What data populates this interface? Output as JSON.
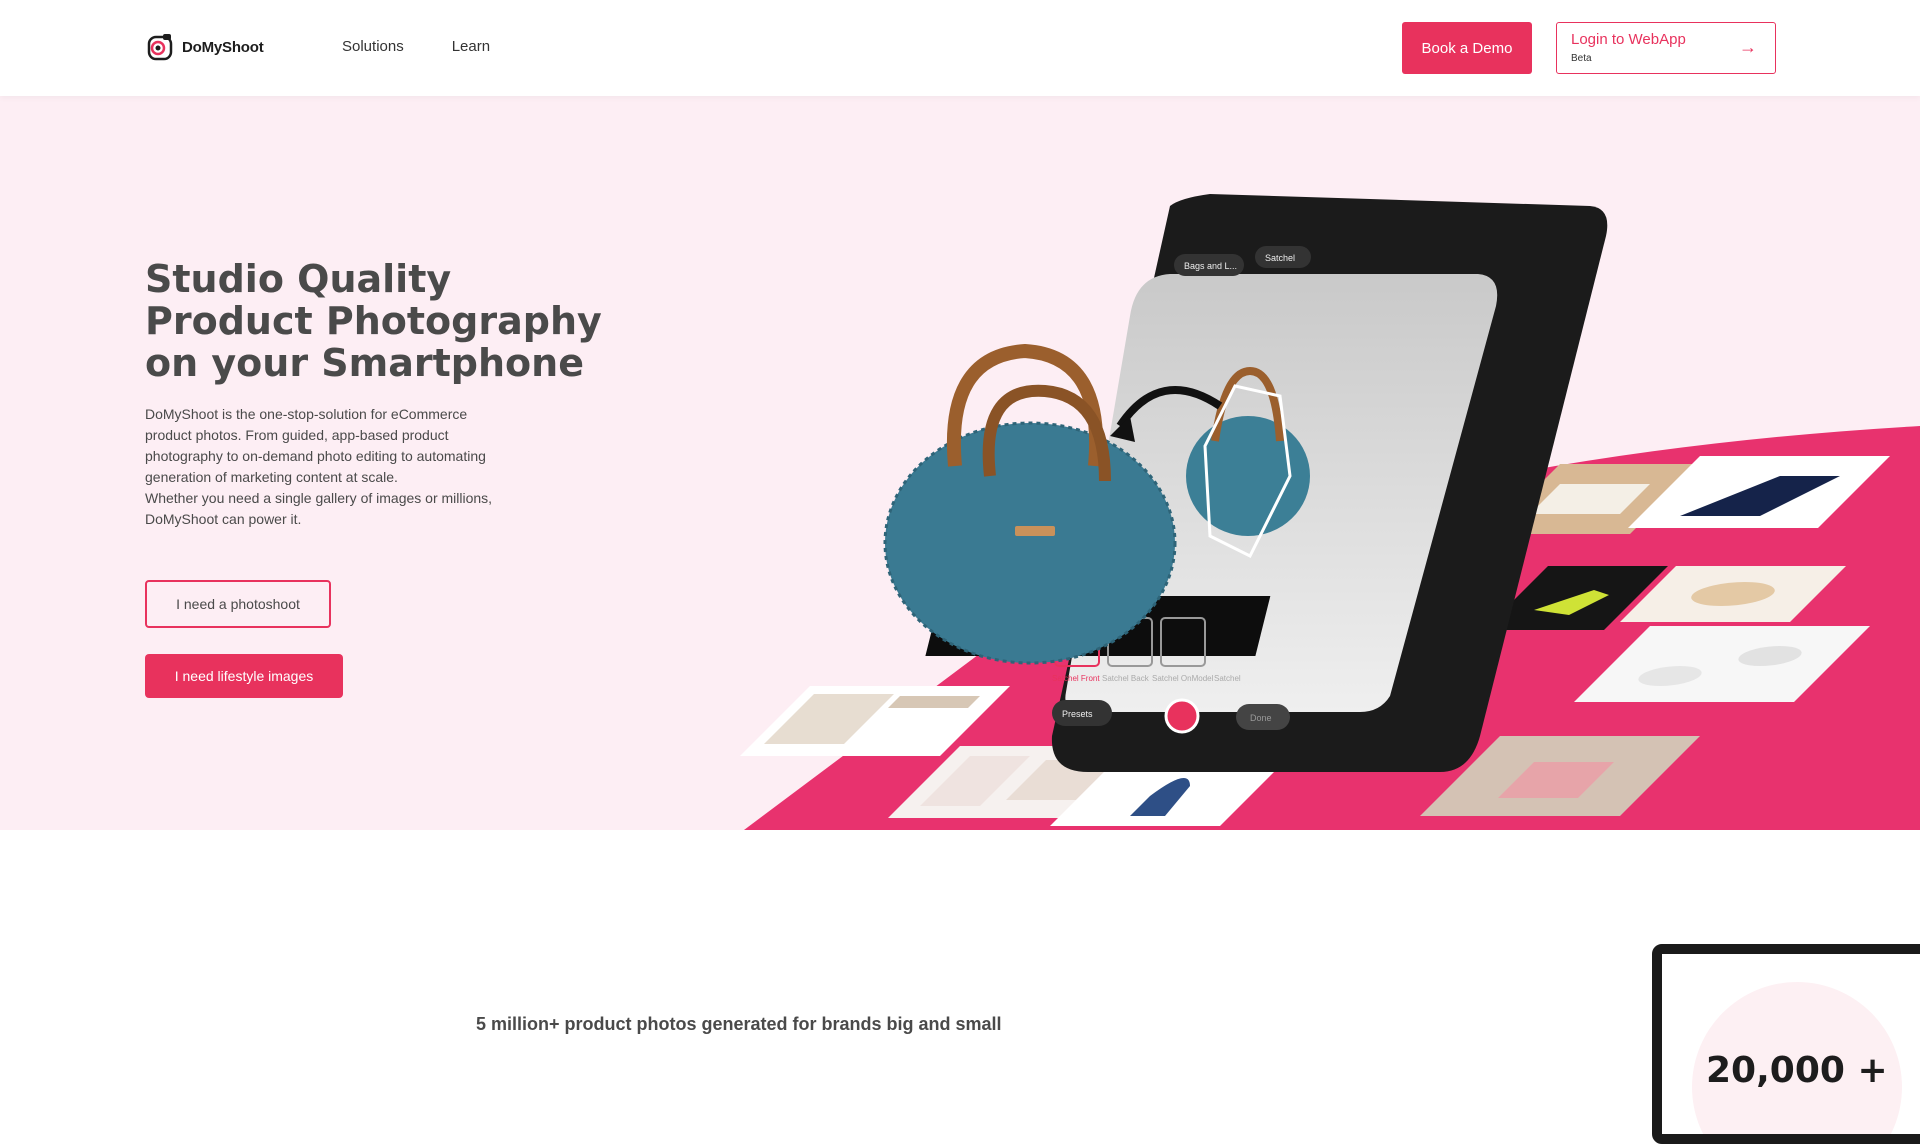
{
  "brand": {
    "name": "DoMyShoot",
    "accent": "#e8325d",
    "hero_bg": "#fdeef4"
  },
  "nav": {
    "items": [
      {
        "label": "Solutions"
      },
      {
        "label": "Learn"
      }
    ]
  },
  "header": {
    "demo_label": "Book a Demo",
    "login_label": "Login to WebApp",
    "login_sub": "Beta"
  },
  "hero": {
    "title_line1": "Studio Quality",
    "title_line2": "Product Photography",
    "title_line3": "on your Smartphone",
    "description_1": "DoMyShoot is the one-stop-solution for eCommerce product photos. From guided, app-based product photography to on-demand photo editing to automating generation of marketing content at scale.",
    "description_2": "Whether you need a single gallery of images or millions, DoMyShoot can power it.",
    "cta_photoshoot": "I need a photoshoot",
    "cta_lifestyle": "I need lifestyle images"
  },
  "phone_ui": {
    "chip_category": "Bags and L...",
    "chip_type": "Satchel",
    "thumbs": [
      "Satchel Front",
      "Satchel Back",
      "Satchel OnModel",
      "Satchel"
    ],
    "presets_label": "Presets",
    "done_label": "Done"
  },
  "stats": {
    "heading": "5 million+ product photos generated for brands big and small",
    "count": "20,000 +"
  }
}
